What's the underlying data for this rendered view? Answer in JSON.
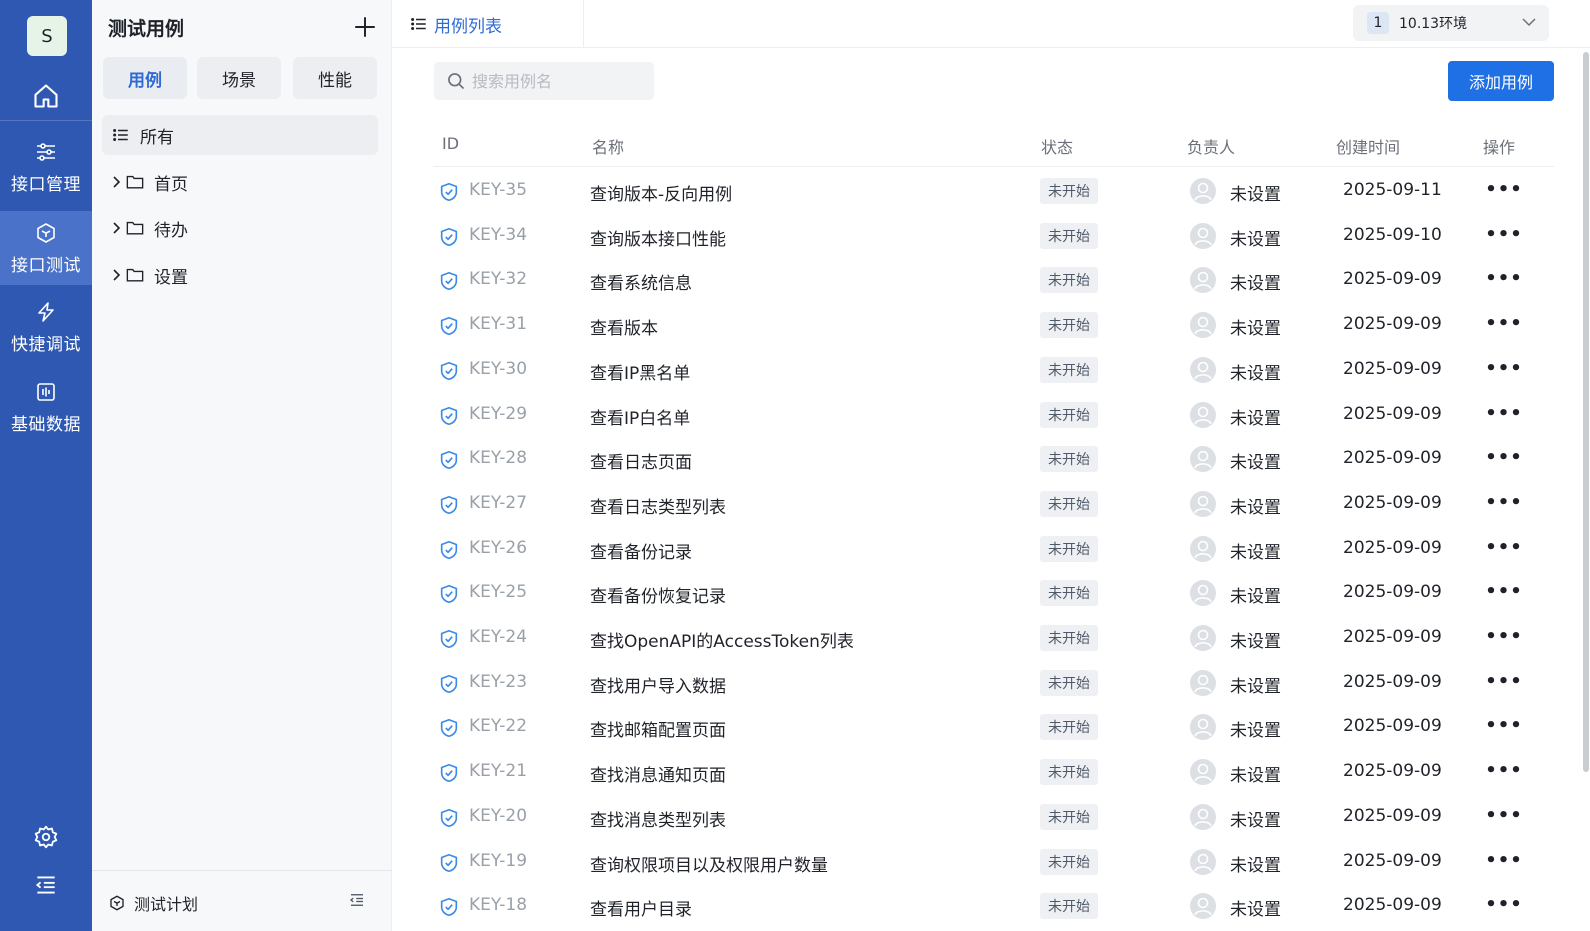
{
  "rail": {
    "avatar_letter": "S",
    "items": [
      {
        "label": "接口管理"
      },
      {
        "label": "接口测试"
      },
      {
        "label": "快捷调试"
      },
      {
        "label": "基础数据"
      }
    ],
    "active_index": 1,
    "bg_color": "#2f58b3"
  },
  "sidebar": {
    "title": "测试用例",
    "segments": [
      "用例",
      "场景",
      "性能"
    ],
    "active_segment": 0,
    "tree_all": "所有",
    "folders": [
      "首页",
      "待办",
      "设置"
    ],
    "bottom_label": "测试计划"
  },
  "topbar": {
    "tab_label": "用例列表",
    "env_badge": "1",
    "env_label": "10.13环境"
  },
  "main": {
    "search_placeholder": "搜索用例名",
    "add_button": "添加用例",
    "accent": "#1f6fe5",
    "columns": [
      "ID",
      "名称",
      "状态",
      "负责人",
      "创建时间",
      "操作"
    ],
    "rows": [
      {
        "id": "KEY-35",
        "name": "查询版本-反向用例",
        "status": "未开始",
        "owner": "未设置",
        "created": "2025-09-11"
      },
      {
        "id": "KEY-34",
        "name": "查询版本接口性能",
        "status": "未开始",
        "owner": "未设置",
        "created": "2025-09-10"
      },
      {
        "id": "KEY-32",
        "name": "查看系统信息",
        "status": "未开始",
        "owner": "未设置",
        "created": "2025-09-09"
      },
      {
        "id": "KEY-31",
        "name": "查看版本",
        "status": "未开始",
        "owner": "未设置",
        "created": "2025-09-09"
      },
      {
        "id": "KEY-30",
        "name": "查看IP黑名单",
        "status": "未开始",
        "owner": "未设置",
        "created": "2025-09-09"
      },
      {
        "id": "KEY-29",
        "name": "查看IP白名单",
        "status": "未开始",
        "owner": "未设置",
        "created": "2025-09-09"
      },
      {
        "id": "KEY-28",
        "name": "查看日志页面",
        "status": "未开始",
        "owner": "未设置",
        "created": "2025-09-09"
      },
      {
        "id": "KEY-27",
        "name": "查看日志类型列表",
        "status": "未开始",
        "owner": "未设置",
        "created": "2025-09-09"
      },
      {
        "id": "KEY-26",
        "name": "查看备份记录",
        "status": "未开始",
        "owner": "未设置",
        "created": "2025-09-09"
      },
      {
        "id": "KEY-25",
        "name": "查看备份恢复记录",
        "status": "未开始",
        "owner": "未设置",
        "created": "2025-09-09"
      },
      {
        "id": "KEY-24",
        "name": "查找OpenAPI的AccessToken列表",
        "status": "未开始",
        "owner": "未设置",
        "created": "2025-09-09"
      },
      {
        "id": "KEY-23",
        "name": "查找用户导入数据",
        "status": "未开始",
        "owner": "未设置",
        "created": "2025-09-09"
      },
      {
        "id": "KEY-22",
        "name": "查找邮箱配置页面",
        "status": "未开始",
        "owner": "未设置",
        "created": "2025-09-09"
      },
      {
        "id": "KEY-21",
        "name": "查找消息通知页面",
        "status": "未开始",
        "owner": "未设置",
        "created": "2025-09-09"
      },
      {
        "id": "KEY-20",
        "name": "查找消息类型列表",
        "status": "未开始",
        "owner": "未设置",
        "created": "2025-09-09"
      },
      {
        "id": "KEY-19",
        "name": "查询权限项目以及权限用户数量",
        "status": "未开始",
        "owner": "未设置",
        "created": "2025-09-09"
      },
      {
        "id": "KEY-18",
        "name": "查看用户目录",
        "status": "未开始",
        "owner": "未设置",
        "created": "2025-09-09"
      }
    ]
  }
}
